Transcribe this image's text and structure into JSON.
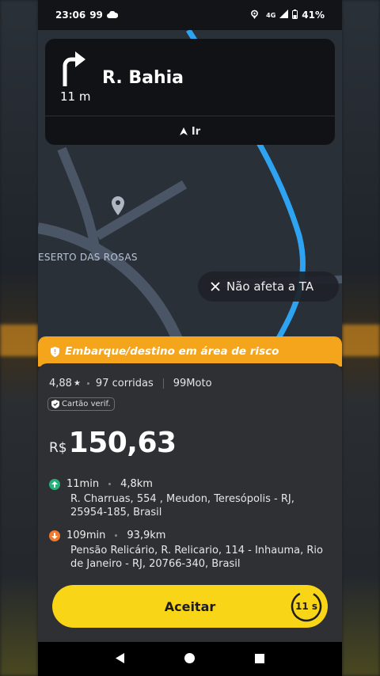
{
  "status_bar": {
    "time": "23:06",
    "brand": "99",
    "network": "4G",
    "battery": "41%",
    "icons": [
      "cloud-icon",
      "location-icon",
      "signal-icon",
      "battery-icon"
    ]
  },
  "map": {
    "area_label": "ESERTO DAS ROSAS",
    "route_color": "#2ea3f2"
  },
  "navigation": {
    "street": "R. Bahia",
    "distance": "11 m",
    "go_label": "Ir",
    "turn_icon": "turn-right-icon"
  },
  "chip": {
    "label": "Não afeta a TA"
  },
  "risk_banner": {
    "text": "Embarque/destino em área de risco",
    "color": "#f5a51c"
  },
  "ride": {
    "rating": "4,88",
    "rides": "97 corridas",
    "service": "99Moto",
    "verified_label": "Cartão verif.",
    "currency": "R$",
    "price": "150,63",
    "pickup": {
      "time": "11min",
      "distance": "4,8km",
      "address": "R. Charruas, 554 , Meudon, Teresópolis - RJ, 25954-185, Brasil",
      "color": "#27b07a"
    },
    "destination": {
      "time": "109min",
      "distance": "93,9km",
      "address": "Pensão Relicário, R. Relicario, 114 - Inhauma, Rio de Janeiro - RJ, 20766-340, Brasil",
      "color": "#ef7a30"
    }
  },
  "accept": {
    "label": "Aceitar",
    "timer": "11 s",
    "color": "#f8d516"
  }
}
